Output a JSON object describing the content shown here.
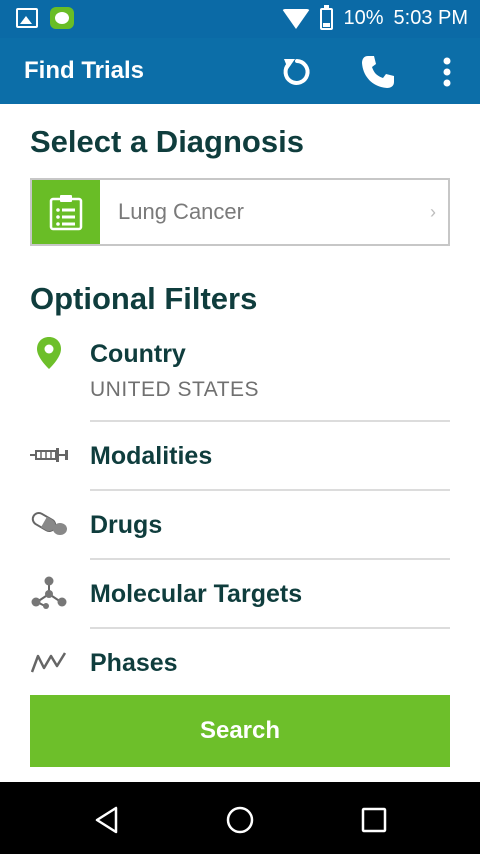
{
  "status_bar": {
    "battery": "10%",
    "time": "5:03 PM"
  },
  "app_bar": {
    "title": "Find Trials",
    "actions": [
      "refresh-icon",
      "phone-icon",
      "more-vert-icon"
    ]
  },
  "diagnosis": {
    "heading": "Select a Diagnosis",
    "value": "Lung Cancer"
  },
  "filters": {
    "heading": "Optional Filters",
    "items": [
      {
        "label": "Country",
        "value": "UNITED STATES",
        "icon": "map-pin-icon"
      },
      {
        "label": "Modalities",
        "icon": "syringe-icon"
      },
      {
        "label": "Drugs",
        "icon": "pill-icon"
      },
      {
        "label": "Molecular Targets",
        "icon": "molecule-icon"
      },
      {
        "label": "Phases",
        "icon": "phases-icon"
      }
    ]
  },
  "search": {
    "label": "Search"
  },
  "colors": {
    "primary": "#0c6ea8",
    "accent": "#6dbf2a",
    "heading": "#0f3d3d"
  }
}
